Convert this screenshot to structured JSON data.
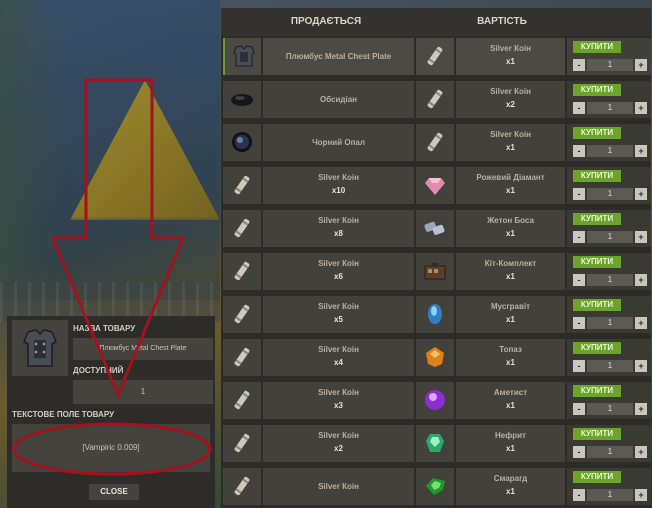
{
  "store": {
    "header_sells": "ПРОДАЄТЬСЯ",
    "header_price": "ВАРТІСТЬ",
    "rows": [
      {
        "sell_name": "Плюмбус Metal Chest Plate",
        "sell_qty": "",
        "sell_icon": "chest-plate-icon",
        "price_name": "Silver Коін",
        "price_qty": "x1",
        "price_icon": "silver-coin-icon",
        "buy_label": "КУПИТИ",
        "amount": "1",
        "minus": "-",
        "plus": "+"
      },
      {
        "sell_name": "Обсидіан",
        "sell_qty": "",
        "sell_icon": "obsidian-icon",
        "price_name": "Silver Коін",
        "price_qty": "x2",
        "price_icon": "silver-coin-icon",
        "buy_label": "КУПИТИ",
        "amount": "1",
        "minus": "-",
        "plus": "+"
      },
      {
        "sell_name": "Чорний Опал",
        "sell_qty": "",
        "sell_icon": "black-opal-icon",
        "price_name": "Silver Коін",
        "price_qty": "x1",
        "price_icon": "silver-coin-icon",
        "buy_label": "КУПИТИ",
        "amount": "1",
        "minus": "-",
        "plus": "+"
      },
      {
        "sell_name": "Silver Коін",
        "sell_qty": "x10",
        "sell_icon": "silver-coin-icon",
        "price_name": "Рожевий Діамант",
        "price_qty": "x1",
        "price_icon": "pink-diamond-icon",
        "buy_label": "КУПИТИ",
        "amount": "1",
        "minus": "-",
        "plus": "+"
      },
      {
        "sell_name": "Silver Коін",
        "sell_qty": "x8",
        "sell_icon": "silver-coin-icon",
        "price_name": "Жетон Боса",
        "price_qty": "x1",
        "price_icon": "boss-token-icon",
        "buy_label": "КУПИТИ",
        "amount": "1",
        "minus": "-",
        "plus": "+"
      },
      {
        "sell_name": "Silver Коін",
        "sell_qty": "x6",
        "sell_icon": "silver-coin-icon",
        "price_name": "Кіт-Комплект",
        "price_qty": "x1",
        "price_icon": "kit-icon",
        "buy_label": "КУПИТИ",
        "amount": "1",
        "minus": "-",
        "plus": "+"
      },
      {
        "sell_name": "Silver Коін",
        "sell_qty": "x5",
        "sell_icon": "silver-coin-icon",
        "price_name": "Мусгравіт",
        "price_qty": "x1",
        "price_icon": "musgravite-icon",
        "buy_label": "КУПИТИ",
        "amount": "1",
        "minus": "-",
        "plus": "+"
      },
      {
        "sell_name": "Silver Коін",
        "sell_qty": "x4",
        "sell_icon": "silver-coin-icon",
        "price_name": "Топаз",
        "price_qty": "x1",
        "price_icon": "topaz-icon",
        "buy_label": "КУПИТИ",
        "amount": "1",
        "minus": "-",
        "plus": "+"
      },
      {
        "sell_name": "Silver Коін",
        "sell_qty": "x3",
        "sell_icon": "silver-coin-icon",
        "price_name": "Аметист",
        "price_qty": "x1",
        "price_icon": "amethyst-icon",
        "buy_label": "КУПИТИ",
        "amount": "1",
        "minus": "-",
        "plus": "+"
      },
      {
        "sell_name": "Silver Коін",
        "sell_qty": "x2",
        "sell_icon": "silver-coin-icon",
        "price_name": "Нефрит",
        "price_qty": "x1",
        "price_icon": "jade-icon",
        "buy_label": "КУПИТИ",
        "amount": "1",
        "minus": "-",
        "plus": "+"
      },
      {
        "sell_name": "Silver Коін",
        "sell_qty": "",
        "sell_icon": "silver-coin-icon",
        "price_name": "Смарагд",
        "price_qty": "x1",
        "price_icon": "emerald-icon",
        "buy_label": "КУПИТИ",
        "amount": "1",
        "minus": "-",
        "plus": "+"
      }
    ]
  },
  "detail": {
    "name_label": "НАЗВА ТОВАРУ",
    "name_value": "Плюмбус Metal Chest Plate",
    "available_label": "ДОСТУПНИЙ",
    "available_value": "1",
    "text_field_label": "ТЕКСТОВЕ ПОЛЕ ТОВАРУ",
    "text_field_value": "[Vampiric 0.009]",
    "close_label": "CLOSE",
    "thumb_icon": "chest-plate-icon"
  },
  "colors": {
    "buy_green": "#6aa42a",
    "annotation_red": "#a3121e",
    "selected_row_accent": "#6c9a3a"
  }
}
